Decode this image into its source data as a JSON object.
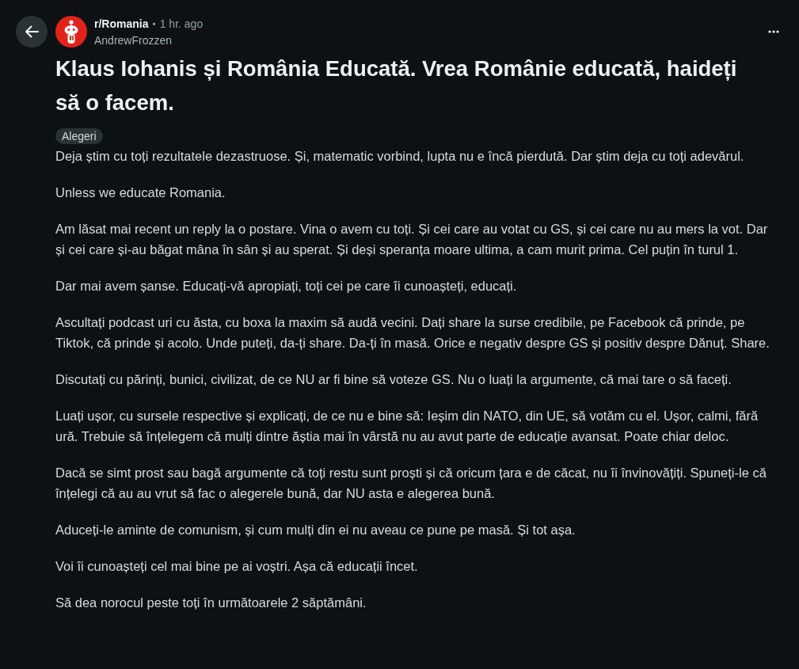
{
  "header": {
    "subreddit": "r/Romania",
    "separator": "•",
    "time": "1 hr. ago",
    "author": "AndrewFrozzen"
  },
  "post": {
    "title": "Klaus Iohanis și România Educată. Vrea Românie educată, haideți să o facem.",
    "flair": "Alegeri",
    "paragraphs": [
      "Deja știm cu toți rezultatele dezastruose. Și, matematic vorbind, lupta nu e încă pierdută. Dar știm deja cu toți adevărul.",
      "Unless we educate Romania.",
      "Am lăsat mai recent un reply la o postare. Vina o avem cu toți. Și cei care au votat cu GS, și cei care nu au mers la vot. Dar și cei care și-au băgat mâna în sân și au sperat. Și deși speranța moare ultima, a cam murit prima. Cel puțin în turul 1.",
      "Dar mai avem șanse. Educați-vă apropiați, toți cei pe care îi cunoașteți, educați.",
      "Ascultați podcast uri cu ăsta, cu boxa la maxim să audă vecini. Dați share la surse credibile, pe Facebook că prinde, pe Tiktok, că prinde și acolo. Unde puteți, da-ți share. Da-ți în masă. Orice e negativ despre GS și positiv despre Dănuț. Share.",
      "Discutați cu părinți, bunici, civilizat, de ce NU ar fi bine să voteze GS. Nu o luați la argumente, că mai tare o să faceți.",
      "Luați ușor, cu sursele respective și explicați, de ce nu e bine să: Ieșim din NATO, din UE, să votăm cu el. Ușor, calmi, fără ură. Trebuie să înțelegem că mulți dintre ăștia mai în vârstă nu au avut parte de educație avansat. Poate chiar deloc.",
      "Dacă se simt prost sau bagă argumente că toți restu sunt proști și că oricum țara e de căcat, nu îi învinovățiți. Spuneți-le că înțelegi că au au vrut să fac o alegerele bună, dar NU asta e alegerea bună.",
      "Aduceți-le aminte de comunism, și cum mulți din ei nu aveau ce pune pe masă. Și tot așa.",
      "Voi îi cunoașteți cel mai bine pe ai voștri. Așa că educații încet.",
      "Să dea norocul peste toți în următoarele 2 săptămâni."
    ]
  }
}
